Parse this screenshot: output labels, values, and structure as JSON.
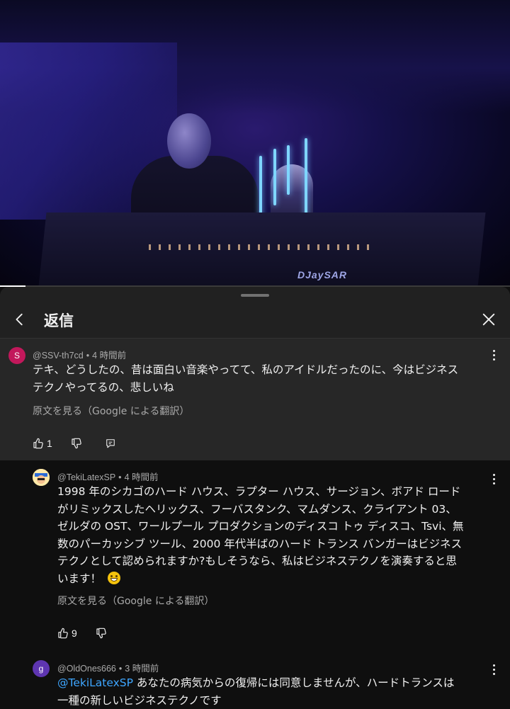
{
  "video": {
    "brand_text": "DJaySAR",
    "progress_fraction": 0.05
  },
  "panel": {
    "title": "返信"
  },
  "parent_comment": {
    "avatar_initial": "S",
    "avatar_color": "#c2185b",
    "author": "@SSV-th7cd",
    "time": "4 時間前",
    "text_line1": "テキ、どうしたの、昔は面白い音楽やってて、私のアイドルだったのに、今はビジネス",
    "text_line2": "テクノやってるの、悲しいね",
    "translate_label": "原文を見る（Google による翻訳）",
    "like_count": "1"
  },
  "replies": [
    {
      "author": "@TekiLatexSP",
      "time": "4 時間前",
      "lines": [
        "1998 年のシカゴのハード ハウス、ラプター ハウス、サージョン、ボアド ロード",
        "がリミックスしたヘリックス、フーバスタンク、マムダンス、クライアント 03、",
        "ゼルダの OST、ワールプール プロダクションのディスコ トゥ ディスコ、Tsvi、無",
        "数のパーカッシブ ツール、2000 年代半ばのハード トランス バンガーはビジネス",
        "テクノとして認められますか?もしそうなら、私はビジネステクノを演奏すると思",
        "います！"
      ],
      "translate_label": "原文を見る（Google による翻訳）",
      "like_count": "9"
    },
    {
      "avatar_initial": "g",
      "avatar_color": "#5e35b1",
      "author": "@OldOnes666",
      "time": "3 時間前",
      "mention": "@TekiLatexSP",
      "line1_rest": " あなたの病気からの復帰には同意しませんが、ハードトランスは",
      "line2": "一種の新しいビジネステクノです"
    }
  ],
  "colors": {
    "sheet_bg": "#212121",
    "highlight_bg": "#272727",
    "reply_bg": "#0f0f0f",
    "mention": "#3ea6ff"
  },
  "icons": {
    "back": "chevron-left-icon",
    "close": "close-icon",
    "like": "thumbs-up-icon",
    "dislike": "thumbs-down-icon",
    "reply": "comment-icon",
    "more": "more-vertical-icon"
  }
}
